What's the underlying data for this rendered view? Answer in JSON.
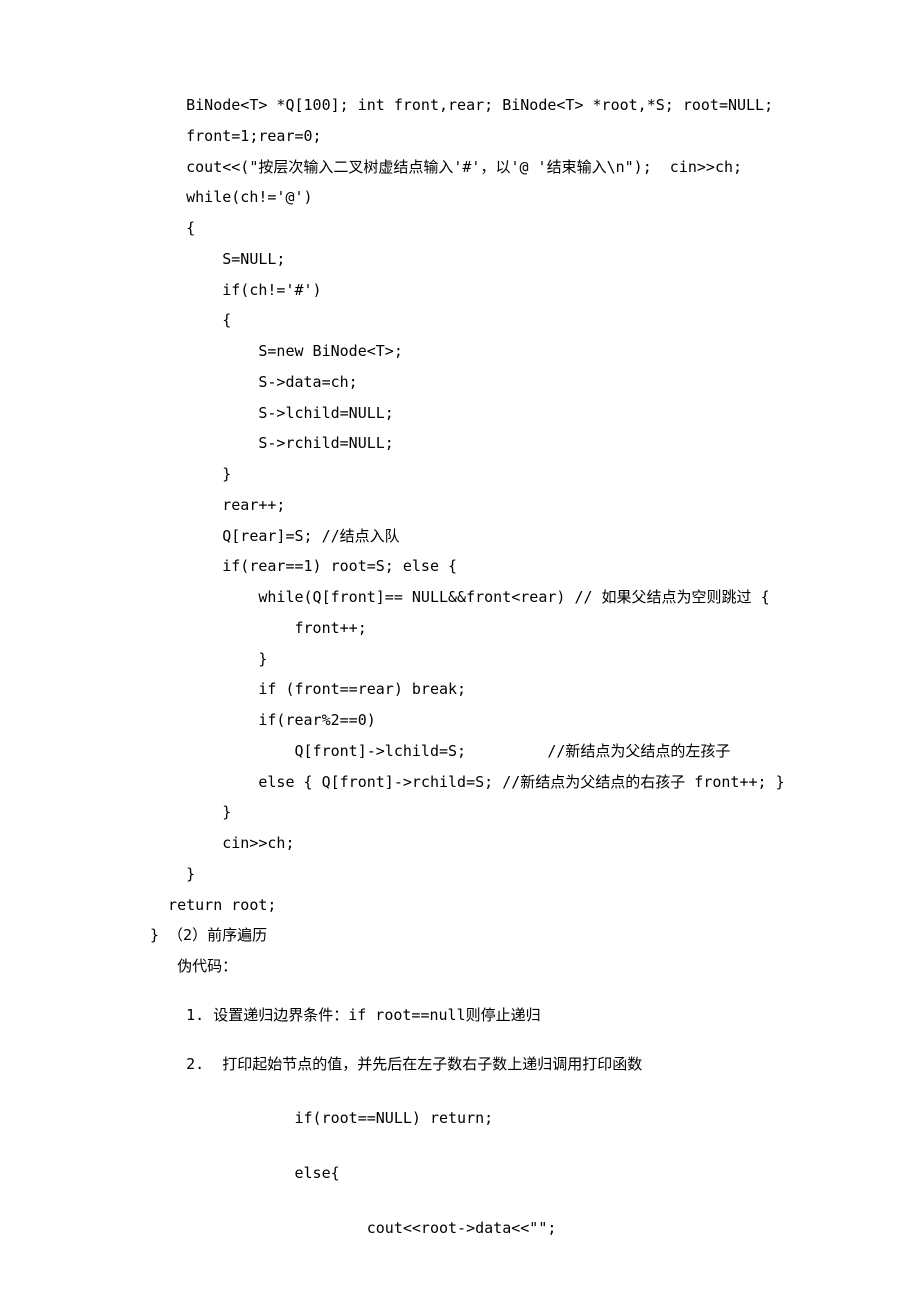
{
  "lines": [
    "    BiNode<T> *Q[100]; int front,rear; BiNode<T> *root,*S; root=NULL;",
    "    front=1;rear=0;",
    "    cout<<(\"按层次输入二叉树虚结点输入'#'，以'@ '结束输入\\n\");  cin>>ch;",
    "    while(ch!='@')",
    "    {",
    "        S=NULL;",
    "        if(ch!='#')",
    "        {",
    "            S=new BiNode<T>;",
    "            S->data=ch;",
    "            S->lchild=NULL;",
    "            S->rchild=NULL;",
    "        }",
    "        rear++;",
    "        Q[rear]=S; //结点入队",
    "        if(rear==1) root=S; else {",
    "            while(Q[front]== NULL&&front<rear) // 如果父结点为空则跳过 {",
    "                front++;",
    "            }",
    "            if (front==rear) break;",
    "            if(rear%2==0)",
    "                Q[front]->lchild=S;         //新结点为父结点的左孩子",
    "            else { Q[front]->rchild=S; //新结点为父结点的右孩子 front++; }",
    "",
    "        }",
    "        cin>>ch;",
    "    }",
    "  return root;",
    "} （2）前序遍历",
    "   伪代码："
  ],
  "steps": [
    "    1. 设置递归边界条件：if root==null则停止递归",
    "    2.  打印起始节点的值，并先后在左子数右子数上递归调用打印函数"
  ],
  "snippets": [
    "                if(root==NULL) return;",
    "                else{",
    "                        cout<<root->data<<\"\";"
  ]
}
